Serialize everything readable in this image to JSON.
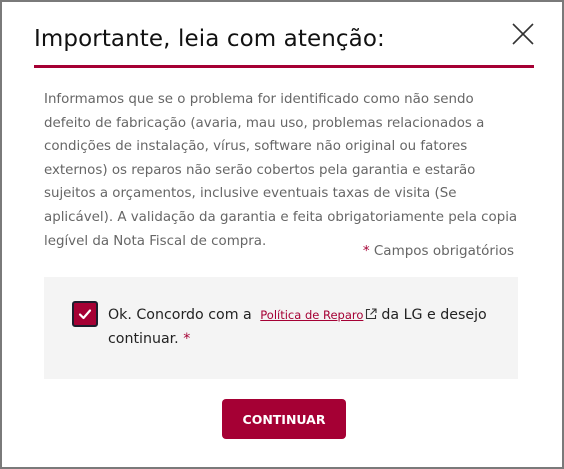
{
  "modal": {
    "title": "Importante, leia com atenção:",
    "body": "Informamos que se o problema for identificado como não sendo defeito de fabricação (avaria, mau uso, problemas relacionados a condições de instalação, vírus, software não original ou fatores externos) os reparos não serão cobertos pela garantia e estarão sujeitos a orçamentos, inclusive eventuais taxas de visita (Se aplicável). A validação da garantia e feita obrigatoriamente pela copia legível da Nota Fiscal de compra.",
    "required_asterisk": "*",
    "required_note": "Campos obrigatórios",
    "close_icon": "close-icon"
  },
  "agreement": {
    "checked": true,
    "text_before": "Ok. Concordo com a",
    "link_label": "Política de Reparo",
    "link_icon": "external-link-icon",
    "text_after": "da LG e desejo continuar.",
    "required_asterisk": "*"
  },
  "actions": {
    "continue_label": "CONTINUAR"
  },
  "colors": {
    "accent": "#a50034",
    "text": "#666666",
    "panel": "#f4f4f4"
  }
}
